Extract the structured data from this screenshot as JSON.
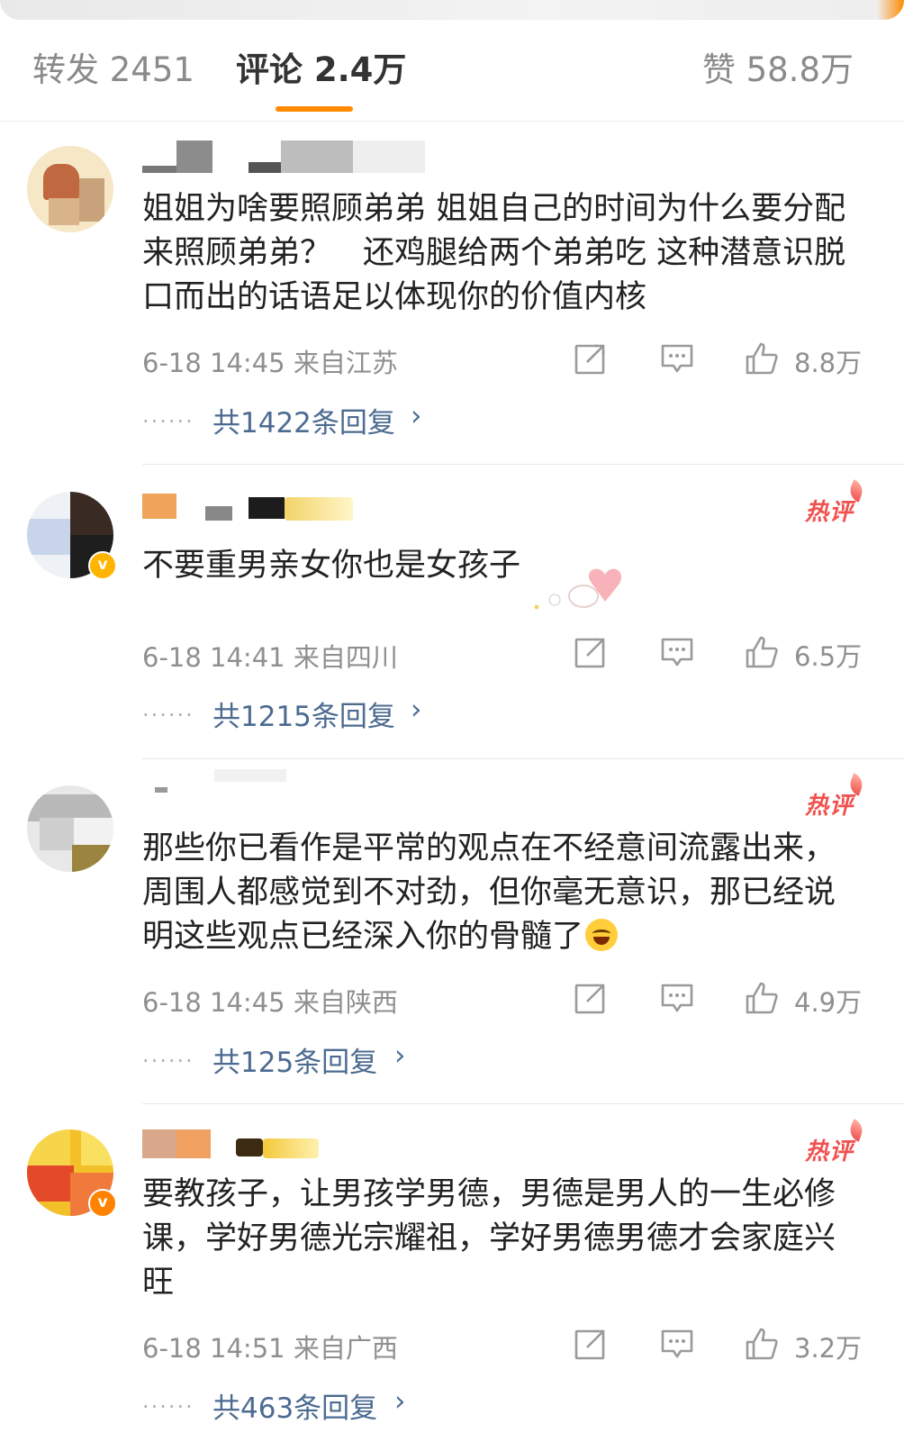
{
  "tabs": {
    "repost": "转发 2451",
    "comment": "评论 2.4万",
    "likes": "赞 58.8万"
  },
  "accent_color": "#ff8a00",
  "hot_color": "#f0514f",
  "link_color": "#4c6b91",
  "comments": [
    {
      "text": "姐姐为啥要照顾弟弟 姐姐自己的时间为什么要分配来照顾弟弟？　还鸡腿给两个弟弟吃 这种潜意识脱口而出的话语足以体现你的价值内核",
      "time_location": "6-18 14:45  来自江苏",
      "likes": "8.8万",
      "replies": "共1422条回复",
      "hot": ""
    },
    {
      "text": "不要重男亲女你也是女孩子",
      "time_location": "6-18 14:41  来自四川",
      "likes": "6.5万",
      "replies": "共1215条回复",
      "hot": "热评"
    },
    {
      "text": "那些你已看作是平常的观点在不经意间流露出来，周围人都感觉到不对劲，但你毫无意识，那已经说明这些观点已经深入你的骨髓了",
      "time_location": "6-18 14:45  来自陕西",
      "likes": "4.9万",
      "replies": "共125条回复",
      "hot": "热评"
    },
    {
      "text": "要教孩子，让男孩学男德，男德是男人的一生必修课，学好男德光宗耀祖，学好男德男德才会家庭兴旺",
      "time_location": "6-18 14:51  来自广西",
      "likes": "3.2万",
      "replies": "共463条回复",
      "hot": "热评"
    }
  ],
  "icons": {
    "share": "share-icon",
    "comment": "comment-icon",
    "like": "like-icon",
    "chevron": "chevron-right-icon",
    "emoji": "laughing-tears-emoji"
  },
  "chevron_glyph": "›",
  "dots_glyph": "······"
}
